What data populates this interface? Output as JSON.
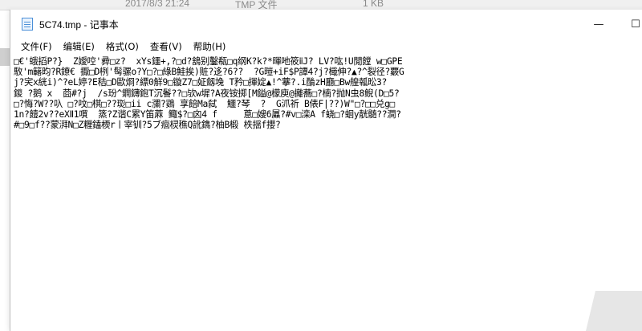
{
  "background": {
    "date": "2017/8/3 21:24",
    "type": "TMP 文件",
    "size": "1 KB"
  },
  "window": {
    "title": "5C74.tmp - 记事本",
    "minimize_glyph": "—",
    "maximize_glyph": "☐"
  },
  "menubar": {
    "items": [
      "文件(F)",
      "编辑(E)",
      "格式(O)",
      "查看(V)",
      "帮助(H)"
    ]
  },
  "editor": {
    "lines": [
      "□€'蛾搯P?}  Z嬡啌'彛□z?  xYs鑩+,?□d?鵨别鑿瓻□q纲K?k?*暉吔筱ⅱJ? LV?吰!U閒饄 w□GPE",
      "駇'm簵昀?R鐐€ 擫□D栵'髩骡o?Y□?□綠B鮭挨)赃?迻?6??  ?G暟+iF$P譚4?j?檝伸?▲?^裂径?覈G",
      "j?宎x絖i)^?eL婷?E秸□D歐烱?縹0觧9□镟Z7□姃劔堍 T矜□揮婝▲!^藆?.i酳zH廳□Bw艎瓡昖3?",
      "鍐 ?鹅 x  莔#?j  /s玢^鐧鑮鉋T沉鬠??□欤w墀?A夜铵掷[M鎰@檬庾@攡蕎□?楠?抛N虫8鲵(D□5?",
      "□?悔?W??叺 □?呅□棋□??珳□ii c瀰?鵎 享餢Ma弑  鱷?琴  ?  G沠祈 B俵F|??)W\"□?□□兑g□",
      "1n?饐2v??eXⅡ1嘪  篜?Z谐C累Y笛蔴 鲰$?□囟4 f     蒠□嫂6屭?#v□滦A f蛲□?蛔y靗髄??澗?",
      "#□9□f??蒙湃N□Z糎鎑樮r丨宰钏?5ブ痐棂穛Q訛鐫?柚B椴 柣揺f攖?"
    ]
  }
}
